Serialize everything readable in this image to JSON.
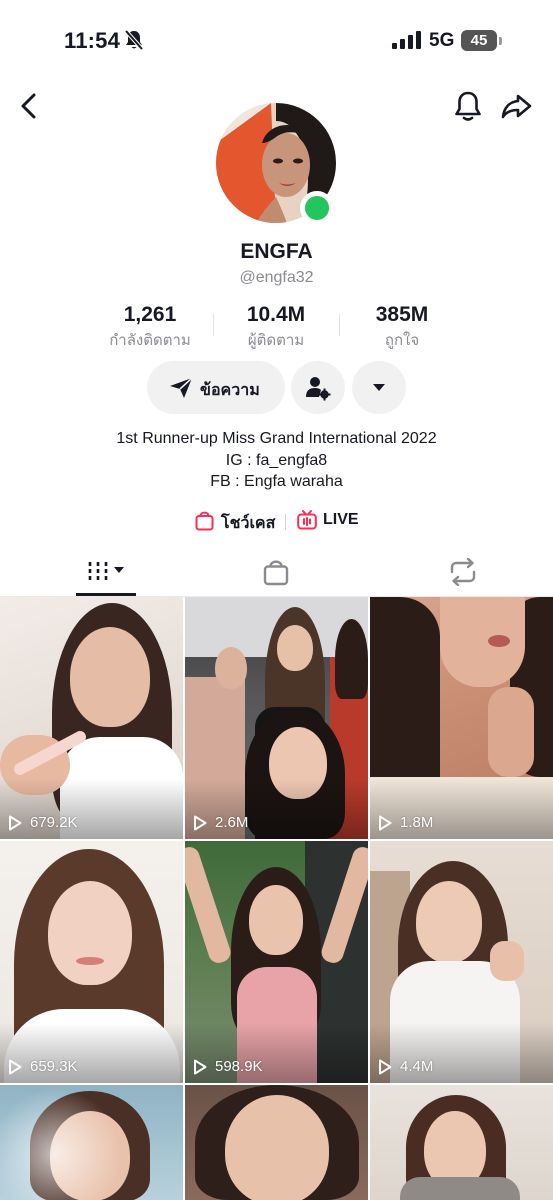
{
  "status_bar": {
    "time": "11:54",
    "network": "5G",
    "battery": "45",
    "icons": [
      "bell-slash-icon",
      "signal-bars-icon",
      "battery-icon"
    ]
  },
  "nav": {
    "icons": [
      "chevron-left-icon",
      "bell-icon",
      "share-arrow-icon"
    ]
  },
  "profile": {
    "display_name": "ENGFA",
    "username": "@engfa32",
    "online_color": "#22c55e"
  },
  "stats": [
    {
      "value": "1,261",
      "label": "กำลังติดตาม"
    },
    {
      "value": "10.4M",
      "label": "ผู้ติดตาม"
    },
    {
      "value": "385M",
      "label": "ถูกใจ"
    }
  ],
  "actions": {
    "message_label": "ข้อความ",
    "icons": [
      "send-icon",
      "user-settings-icon",
      "caret-down-icon"
    ]
  },
  "bio": {
    "line1": "1st Runner-up Miss Grand International 2022",
    "line2": "IG : fa_engfa8",
    "line3": "FB : Engfa waraha"
  },
  "links": {
    "showcase_label": "โชว์เคส",
    "live_label": "LIVE",
    "accent_color": "#fe2c55"
  },
  "tabs": {
    "icons": [
      "videos-grid-icon",
      "shopping-bag-icon",
      "repost-icon"
    ],
    "active": "videos"
  },
  "videos": [
    {
      "views": "679.2K"
    },
    {
      "views": "2.6M"
    },
    {
      "views": "1.8M"
    },
    {
      "views": "659.3K"
    },
    {
      "views": "598.9K"
    },
    {
      "views": "4.4M"
    },
    {
      "views": ""
    },
    {
      "views": ""
    },
    {
      "views": ""
    }
  ]
}
